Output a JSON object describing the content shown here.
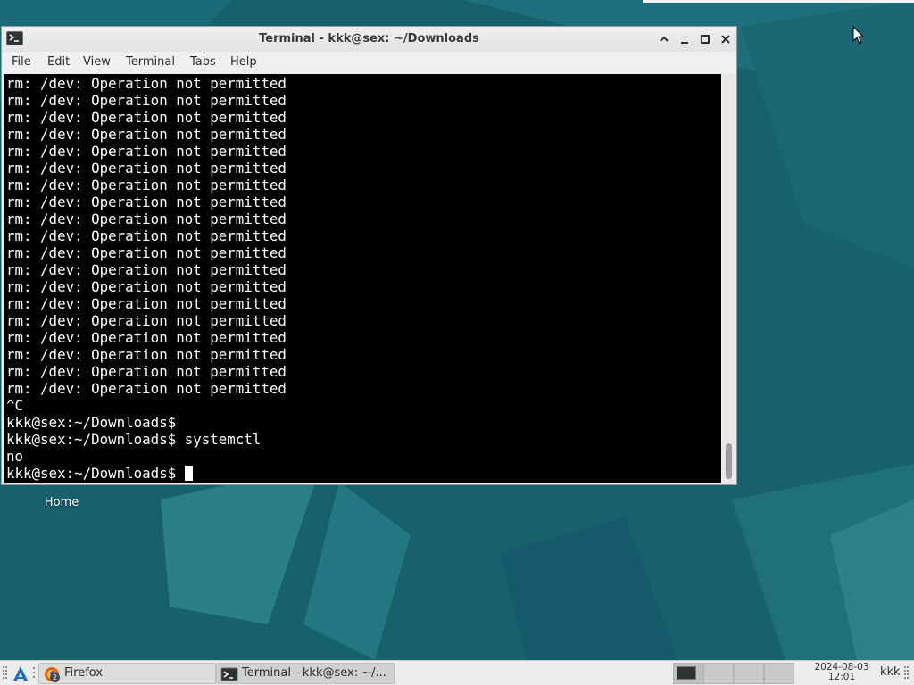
{
  "terminal": {
    "title": "Terminal - kkk@sex: ~/Downloads",
    "menu": [
      "File",
      "Edit",
      "View",
      "Terminal",
      "Tabs",
      "Help"
    ],
    "lines": [
      "rm: /dev: Operation not permitted",
      "rm: /dev: Operation not permitted",
      "rm: /dev: Operation not permitted",
      "rm: /dev: Operation not permitted",
      "rm: /dev: Operation not permitted",
      "rm: /dev: Operation not permitted",
      "rm: /dev: Operation not permitted",
      "rm: /dev: Operation not permitted",
      "rm: /dev: Operation not permitted",
      "rm: /dev: Operation not permitted",
      "rm: /dev: Operation not permitted",
      "rm: /dev: Operation not permitted",
      "rm: /dev: Operation not permitted",
      "rm: /dev: Operation not permitted",
      "rm: /dev: Operation not permitted",
      "rm: /dev: Operation not permitted",
      "rm: /dev: Operation not permitted",
      "rm: /dev: Operation not permitted",
      "rm: /dev: Operation not permitted",
      "^C",
      "kkk@sex:~/Downloads$",
      "kkk@sex:~/Downloads$ systemctl",
      "no"
    ],
    "prompt": "kkk@sex:~/Downloads$ ",
    "colors": {
      "background": "#000000",
      "foreground": "#ffffff"
    }
  },
  "desktop": {
    "icons": [
      {
        "label": "Home"
      }
    ],
    "colors": {
      "wallpaper": "#17616e"
    }
  },
  "taskbar": {
    "tasks": [
      {
        "label": "Firefox",
        "icon": "firefox-icon",
        "badge": "2"
      },
      {
        "label": "Terminal - kkk@sex: ~/...",
        "icon": "terminal-icon",
        "active": true
      }
    ],
    "clock": {
      "date": "2024-08-03",
      "time": "12:01"
    },
    "user": "kkk"
  }
}
